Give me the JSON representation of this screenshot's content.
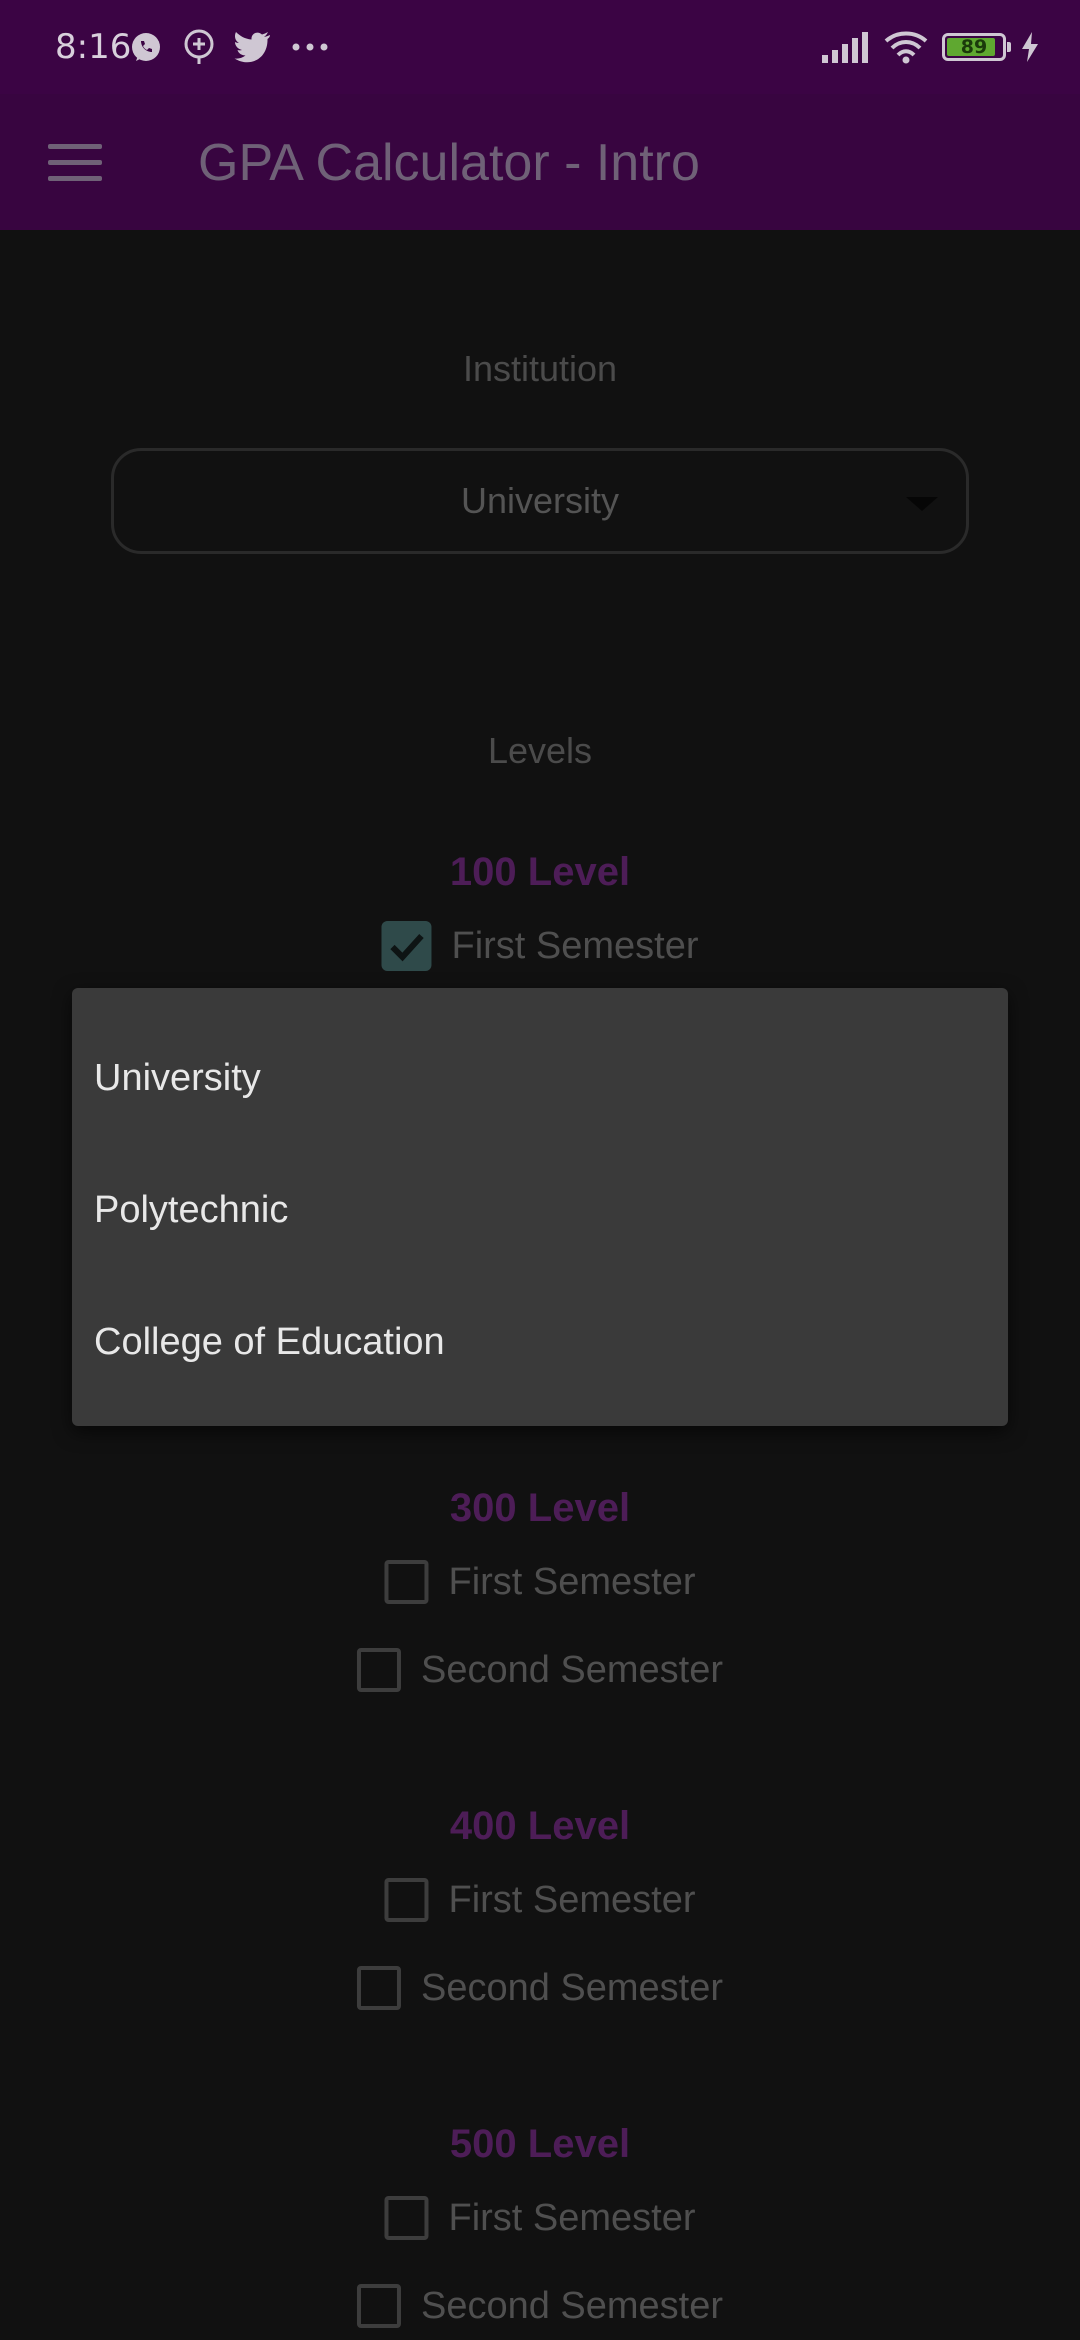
{
  "status_bar": {
    "time": "8:16",
    "left_icons": [
      "whatsapp-icon",
      "chat-plus-icon",
      "twitter-icon",
      "more-dots-icon"
    ],
    "battery_level": "89",
    "right_icons": [
      "signal-icon",
      "wifi-icon",
      "battery-icon",
      "charging-icon"
    ]
  },
  "app_bar": {
    "title": "GPA Calculator - Intro",
    "menu_icon": "hamburger-menu-icon"
  },
  "institution": {
    "label": "Institution",
    "selected": "University"
  },
  "levels": {
    "label": "Levels",
    "groups": [
      {
        "title": "100 Level",
        "options": [
          {
            "label": "First Semester",
            "checked": true
          }
        ]
      },
      {
        "title": "300 Level",
        "options": [
          {
            "label": "First Semester",
            "checked": false
          },
          {
            "label": "Second Semester",
            "checked": false
          }
        ]
      },
      {
        "title": "400 Level",
        "options": [
          {
            "label": "First Semester",
            "checked": false
          },
          {
            "label": "Second Semester",
            "checked": false
          }
        ]
      },
      {
        "title": "500 Level",
        "options": [
          {
            "label": "First Semester",
            "checked": false
          },
          {
            "label": "Second Semester",
            "checked": false
          }
        ]
      }
    ]
  },
  "dropdown": {
    "options": [
      "University",
      "Polytechnic",
      "College of Education"
    ]
  },
  "colors": {
    "status_bar_bg": "#3b0444",
    "app_bar_bg": "#380540",
    "background": "#111111",
    "level_title": "#4d1d57",
    "dropdown_bg": "#3a3a3a",
    "checked_box": "#2f4a4a"
  }
}
